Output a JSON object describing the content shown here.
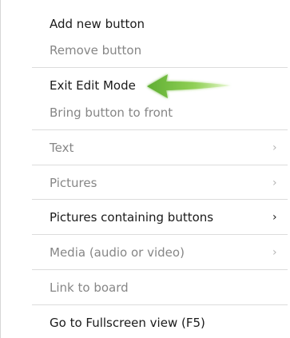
{
  "menu": {
    "items": [
      {
        "label": "Add new button",
        "enabled": true
      },
      {
        "label": "Remove button",
        "enabled": false
      },
      {
        "label": "Exit Edit Mode",
        "enabled": true
      },
      {
        "label": "Bring button to front",
        "enabled": false
      },
      {
        "label": "Text",
        "enabled": false,
        "submenu_glyph": "›"
      },
      {
        "label": "Pictures",
        "enabled": false,
        "submenu_glyph": "›"
      },
      {
        "label": "Pictures containing buttons",
        "enabled": true,
        "submenu_glyph": "›"
      },
      {
        "label": "Media (audio or video)",
        "enabled": false,
        "submenu_glyph": "›"
      },
      {
        "label": "Link to board",
        "enabled": false
      },
      {
        "label": "Go to Fullscreen view (F5)",
        "enabled": true
      }
    ]
  },
  "annotation": {
    "icon": "arrow-left-icon",
    "color": "#7cc142"
  },
  "colors": {
    "enabled_text": "#1a1a1a",
    "disabled_text": "#868686",
    "separator": "#dcdcdc"
  }
}
